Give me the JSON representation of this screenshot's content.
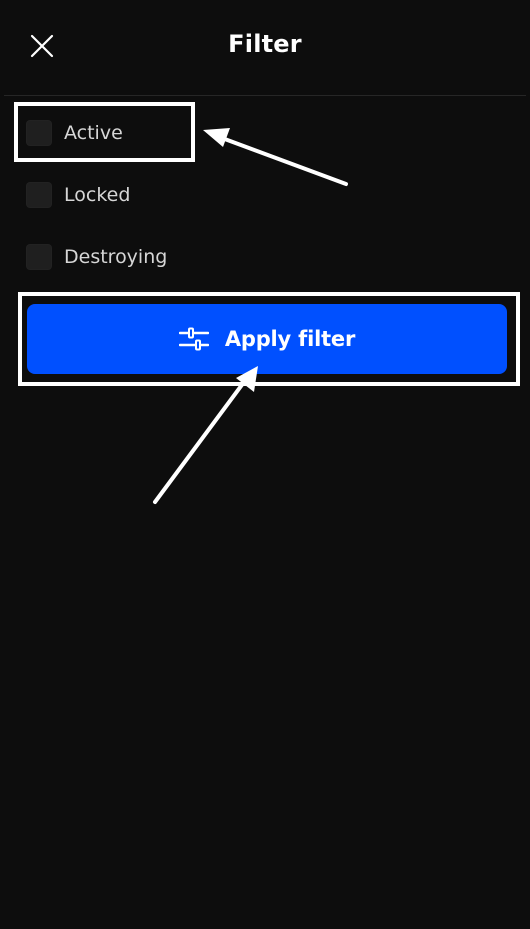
{
  "header": {
    "title": "Filter",
    "close_icon": "close-icon"
  },
  "filter_options": [
    {
      "label": "Active",
      "checked": false
    },
    {
      "label": "Locked",
      "checked": false
    },
    {
      "label": "Destroying",
      "checked": false
    }
  ],
  "apply_button": {
    "label": "Apply filter",
    "icon": "sliders-icon"
  },
  "colors": {
    "background": "#0d0d0d",
    "accent": "#0050ff",
    "annotation": "#ffffff"
  }
}
